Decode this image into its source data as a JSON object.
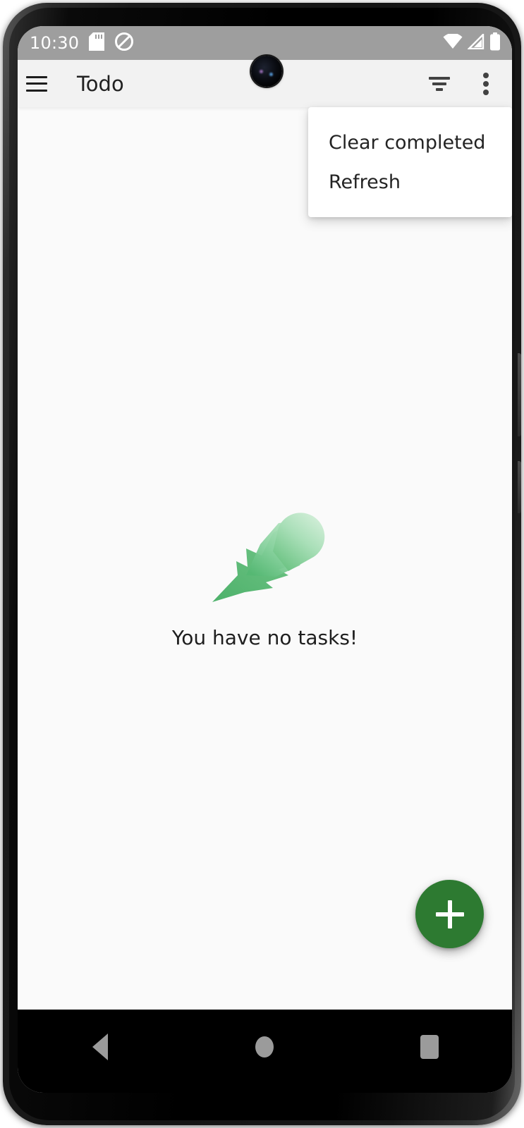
{
  "status_bar": {
    "clock": "10:30",
    "icons_left": [
      "sd-card-icon",
      "do-not-disturb-icon"
    ],
    "icons_right": [
      "wifi-icon",
      "cellular-signal-icon",
      "battery-icon"
    ],
    "background_color": "#9e9e9e",
    "foreground_color": "#ffffff"
  },
  "app_bar": {
    "menu_icon": "hamburger-menu-icon",
    "title": "Todo",
    "actions": [
      {
        "name": "filter-icon",
        "label": "Filter"
      },
      {
        "name": "overflow-menu-icon",
        "label": "More options"
      }
    ],
    "background_color": "#f2f2f2"
  },
  "overflow_menu": {
    "visible": true,
    "items": [
      {
        "label": "Clear completed"
      },
      {
        "label": "Refresh"
      }
    ]
  },
  "content": {
    "empty_state": {
      "illustration": "feather-quill-icon",
      "message": "You have no tasks!",
      "illustration_colors": {
        "light": "#c6e8cd",
        "mid": "#8fd3a3",
        "dark": "#53b56f"
      }
    },
    "background_color": "#fafafa"
  },
  "fab": {
    "icon": "plus-icon",
    "label": "Add task",
    "color": "#2d7a31"
  },
  "navigation_bar": {
    "buttons": [
      {
        "name": "nav-back-button",
        "label": "Back"
      },
      {
        "name": "nav-home-button",
        "label": "Home"
      },
      {
        "name": "nav-recents-button",
        "label": "Recents"
      }
    ],
    "background_color": "#000000",
    "icon_color": "#9b9b9b"
  }
}
